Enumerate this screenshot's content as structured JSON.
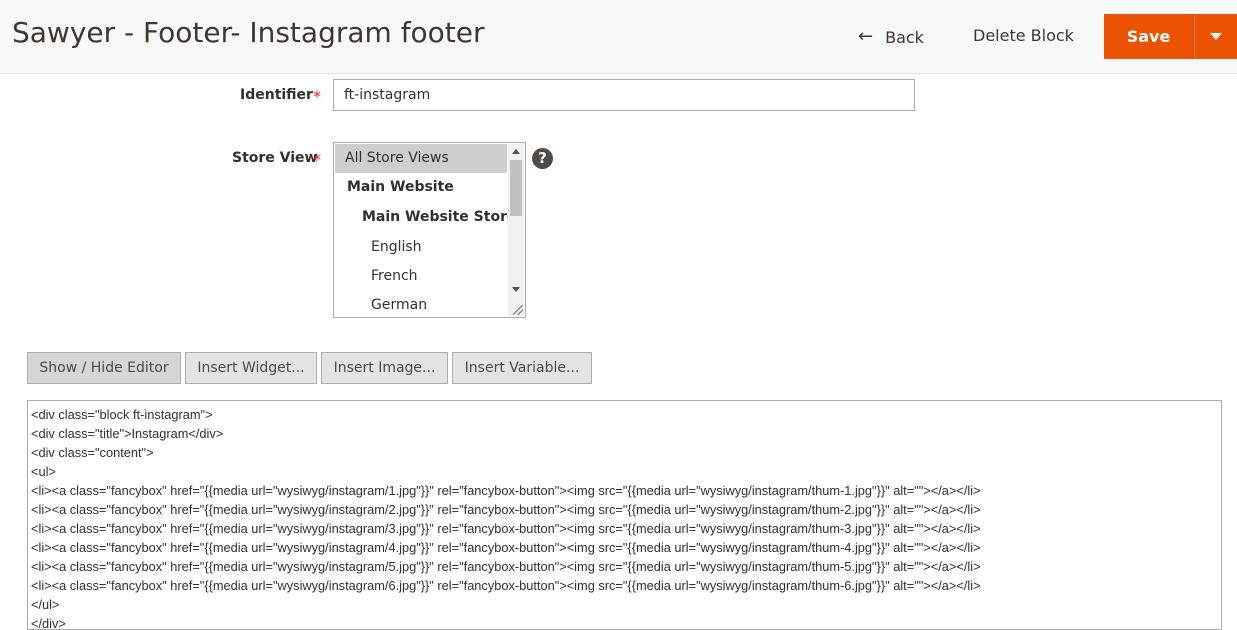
{
  "header": {
    "title": "Sawyer - Footer- Instagram footer",
    "back_label": "Back",
    "delete_label": "Delete Block",
    "save_label": "Save"
  },
  "form": {
    "identifier": {
      "label": "Identifier",
      "required_mark": "*",
      "value": "ft-instagram"
    },
    "store_view": {
      "label": "Store View",
      "required_mark": "*",
      "help_icon": "?",
      "options": [
        {
          "label": "All Store Views",
          "selected": true
        },
        {
          "label": "Main Website",
          "selected": false
        },
        {
          "label": "Main Website Store",
          "selected": false
        },
        {
          "label": "English",
          "selected": false
        },
        {
          "label": "French",
          "selected": false
        },
        {
          "label": "German",
          "selected": false
        }
      ]
    }
  },
  "editor": {
    "buttons": {
      "show_hide": "Show / Hide Editor",
      "insert_widget": "Insert Widget...",
      "insert_image": "Insert Image...",
      "insert_variable": "Insert Variable..."
    },
    "content_lines": [
      "<div class=\"block ft-instagram\">",
      "<div class=\"title\">Instagram</div>",
      "<div class=\"content\">",
      "<ul>",
      "<li><a class=\"fancybox\" href=\"{{media url=\"wysiwyg/instagram/1.jpg\"}}\" rel=\"fancybox-button\"><img src=\"{{media url=\"wysiwyg/instagram/thum-1.jpg\"}}\" alt=\"\"></a></li>",
      "<li><a class=\"fancybox\" href=\"{{media url=\"wysiwyg/instagram/2.jpg\"}}\" rel=\"fancybox-button\"><img src=\"{{media url=\"wysiwyg/instagram/thum-2.jpg\"}}\" alt=\"\"></a></li>",
      "<li><a class=\"fancybox\" href=\"{{media url=\"wysiwyg/instagram/3.jpg\"}}\" rel=\"fancybox-button\"><img src=\"{{media url=\"wysiwyg/instagram/thum-3.jpg\"}}\" alt=\"\"></a></li>",
      "<li><a class=\"fancybox\" href=\"{{media url=\"wysiwyg/instagram/4.jpg\"}}\" rel=\"fancybox-button\"><img src=\"{{media url=\"wysiwyg/instagram/thum-4.jpg\"}}\" alt=\"\"></a></li>",
      "<li><a class=\"fancybox\" href=\"{{media url=\"wysiwyg/instagram/5.jpg\"}}\" rel=\"fancybox-button\"><img src=\"{{media url=\"wysiwyg/instagram/thum-5.jpg\"}}\" alt=\"\"></a></li>",
      "<li><a class=\"fancybox\" href=\"{{media url=\"wysiwyg/instagram/6.jpg\"}}\" rel=\"fancybox-button\"><img src=\"{{media url=\"wysiwyg/instagram/thum-6.jpg\"}}\" alt=\"\"></a></li>",
      "</ul>",
      "</div>"
    ]
  },
  "colors": {
    "accent": "#eb5202",
    "required": "#e22626",
    "header_bg": "#f8f8f8"
  }
}
